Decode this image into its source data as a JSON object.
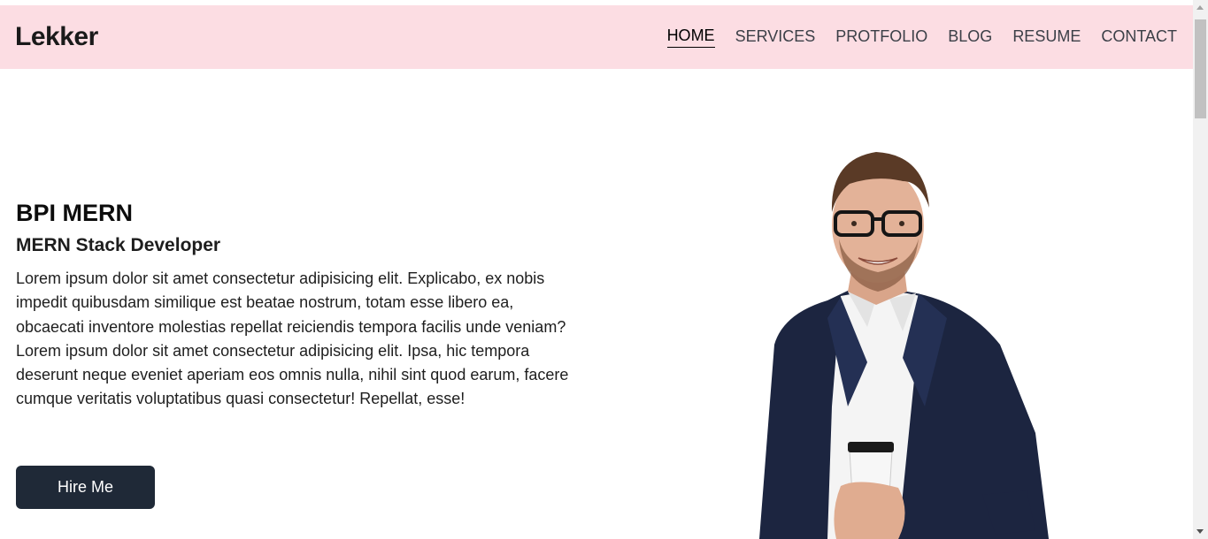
{
  "brand": {
    "logo": "Lekker"
  },
  "nav": {
    "items": [
      {
        "label": "HOME",
        "active": true
      },
      {
        "label": "SERVICES",
        "active": false
      },
      {
        "label": "PROTFOLIO",
        "active": false
      },
      {
        "label": "BLOG",
        "active": false
      },
      {
        "label": "RESUME",
        "active": false
      },
      {
        "label": "CONTACT",
        "active": false
      }
    ]
  },
  "hero": {
    "name": "BPI MERN",
    "role": "MERN Stack Developer",
    "paragraph_1": "Lorem ipsum dolor sit amet consectetur adipisicing elit. Explicabo, ex nobis impedit quibusdam similique est beatae nostrum, totam esse libero ea, obcaecati inventore molestias repellat reiciendis tempora facilis unde veniam?",
    "paragraph_2": "Lorem ipsum dolor sit amet consectetur adipisicing elit. Ipsa, hic tempora deserunt neque eveniet aperiam eos omnis nulla, nihil sint quod earum, facere cumque veritatis voluptatibus quasi consectetur! Repellat, esse!",
    "cta_label": "Hire Me"
  },
  "colors": {
    "navbar_bg": "#fcdde3",
    "button_bg": "#1f2937",
    "text": "#111111"
  }
}
